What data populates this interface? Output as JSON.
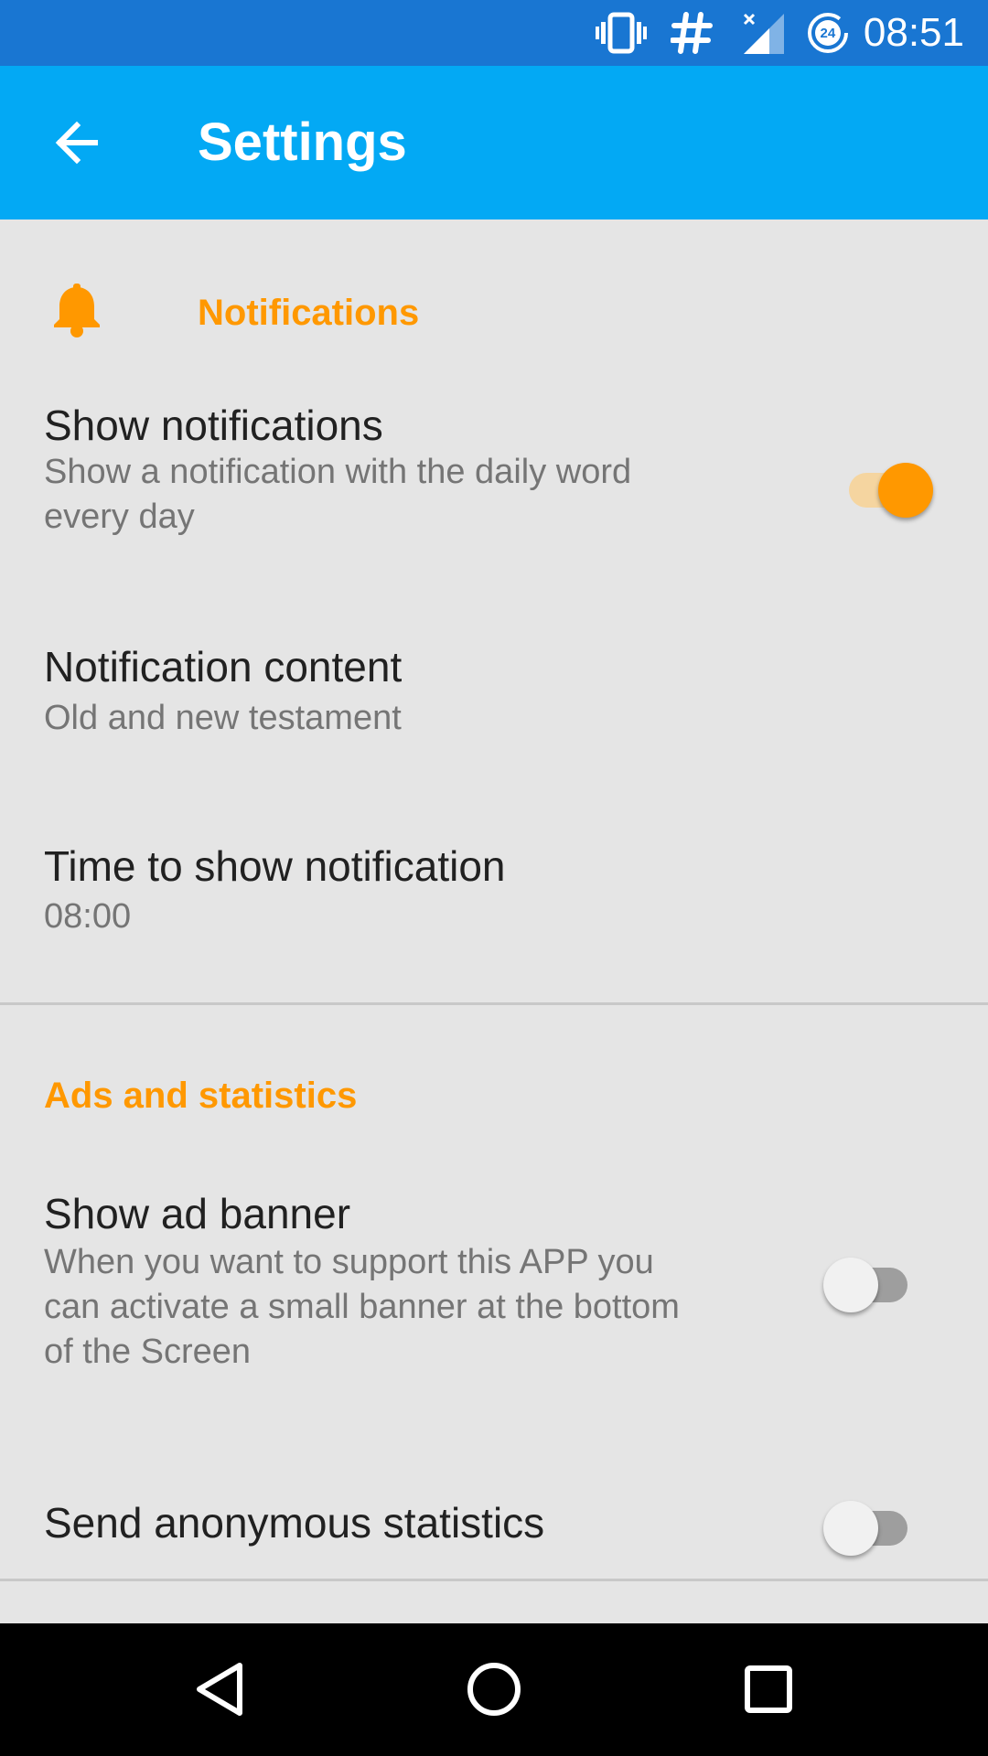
{
  "status_bar": {
    "time": "08:51",
    "data_saver_badge": "24",
    "icons": [
      "vibrate-icon",
      "hash-icon",
      "signal-no-data-icon",
      "data-saver-icon"
    ],
    "background_color": "#1976d2"
  },
  "app_bar": {
    "title": "Settings",
    "back_icon": "arrow-back-icon",
    "background_color": "#03a9f4"
  },
  "accent_color": "#ff9800",
  "sections": {
    "notifications": {
      "header": "Notifications",
      "header_icon": "bell-icon",
      "show_notifications": {
        "title": "Show notifications",
        "summary_line1": "Show a notification with the daily word",
        "summary_line2": "every day",
        "enabled": true
      },
      "notification_content": {
        "title": "Notification content",
        "summary": "Old and new testament"
      },
      "time_to_show": {
        "title": "Time to show notification",
        "summary": "08:00"
      }
    },
    "ads_and_statistics": {
      "header": "Ads and statistics",
      "show_ad_banner": {
        "title": "Show ad banner",
        "summary_line1": "When you want to support this APP you",
        "summary_line2": "can activate a small banner at the bottom",
        "summary_line3": "of the Screen",
        "enabled": false
      },
      "send_statistics": {
        "title": "Send anonymous statistics",
        "enabled": false
      }
    }
  },
  "nav_bar": {
    "icons": [
      "back-triangle-icon",
      "home-circle-icon",
      "recents-square-icon"
    ]
  }
}
